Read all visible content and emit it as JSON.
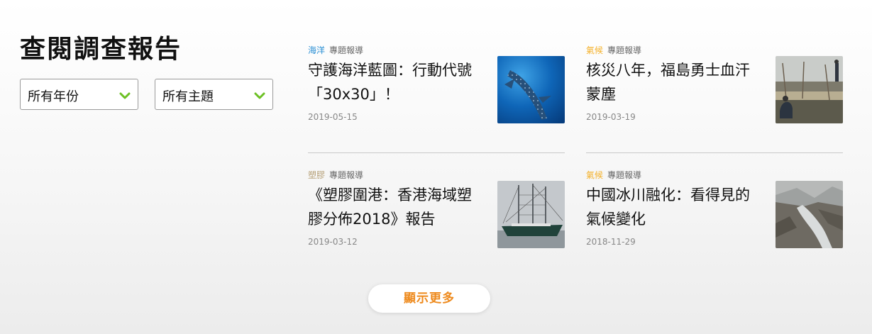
{
  "heading": "查閱調查報告",
  "filters": {
    "year": "所有年份",
    "topic": "所有主題"
  },
  "colors": {
    "accent_green": "#6cc024",
    "more_button_text": "#ee8a1d",
    "tag_ocean": "#2a8fd4",
    "tag_plastic": "#b7a27a",
    "tag_climate": "#f4b12a"
  },
  "articles": [
    {
      "tag": "海洋",
      "type": "專題報導",
      "title": "守護海洋藍圖：行動代號「30x30」！",
      "date": "2019-05-15",
      "image": "whale-shark-photo"
    },
    {
      "tag": "氣候",
      "type": "專題報導",
      "title": "核災八年，福島勇士血汗蒙塵",
      "date": "2019-03-19",
      "image": "fukushima-field-photo"
    },
    {
      "tag": "塑膠",
      "type": "專題報導",
      "title": "《塑膠圍港：香港海域塑膠分佈2018》報告",
      "date": "2019-03-12",
      "image": "sailing-ship-photo"
    },
    {
      "tag": "氣候",
      "type": "專題報導",
      "title": "中國冰川融化：看得見的氣候變化",
      "date": "2018-11-29",
      "image": "glacier-valley-photo"
    }
  ],
  "more_button": "顯示更多"
}
